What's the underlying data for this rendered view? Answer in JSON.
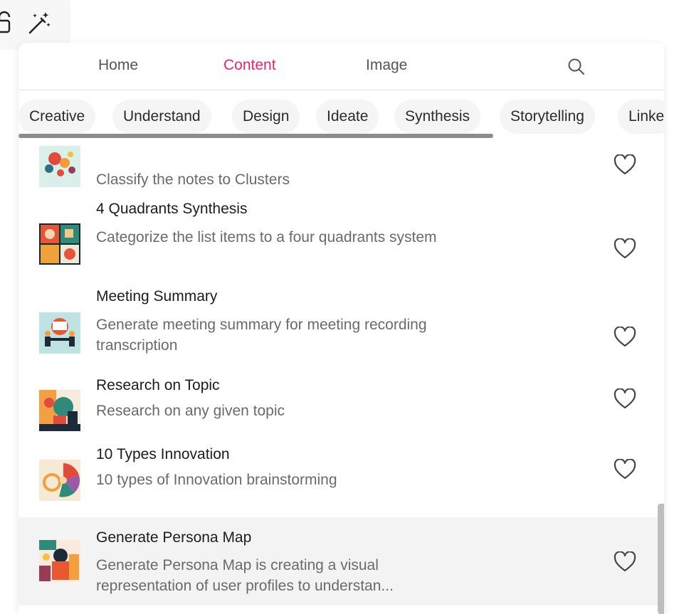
{
  "toolbar": {
    "icons": [
      "unlock-icon",
      "magic-wand-icon"
    ]
  },
  "nav": {
    "tabs": [
      {
        "label": "Home",
        "active": false
      },
      {
        "label": "Content",
        "active": true
      },
      {
        "label": "Image",
        "active": false
      }
    ],
    "search_icon": "search-icon",
    "accent_color": "#e8246a"
  },
  "categories": [
    "Creative",
    "Understand",
    "Design",
    "Ideate",
    "Synthesis",
    "Storytelling",
    "Linke"
  ],
  "items": [
    {
      "title": "",
      "description": "Classify the notes to Clusters",
      "highlighted": false
    },
    {
      "title": "4 Quadrants Synthesis",
      "description": "Categorize the list items to a four quadrants system",
      "highlighted": false
    },
    {
      "title": "Meeting Summary",
      "description": "Generate meeting summary for meeting recording transcription",
      "highlighted": false
    },
    {
      "title": "Research on Topic",
      "description": "Research on any given topic",
      "highlighted": false
    },
    {
      "title": "10 Types Innovation",
      "description": "10 types of Innovation brainstorming",
      "highlighted": false
    },
    {
      "title": "Generate Persona Map",
      "description": "Generate Persona Map is creating a visual representation of user profiles to understan...",
      "highlighted": true
    }
  ]
}
